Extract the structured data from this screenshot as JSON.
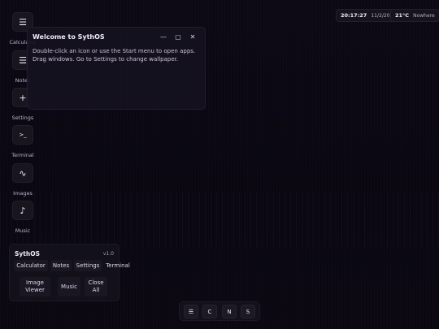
{
  "desktop_icons": [
    {
      "label": "Calculator",
      "glyph": "☰",
      "icon": "calculator-icon"
    },
    {
      "label": "Notes",
      "glyph": "☰",
      "icon": "notes-icon"
    },
    {
      "label": "Settings",
      "glyph": "+",
      "icon": "settings-icon"
    },
    {
      "label": "Terminal",
      "glyph": ">_",
      "icon": "terminal-icon"
    },
    {
      "label": "Images",
      "glyph": "∿",
      "icon": "images-icon"
    },
    {
      "label": "Music",
      "glyph": "♪",
      "icon": "music-icon"
    }
  ],
  "window": {
    "title": "Welcome to SythOS",
    "minimize_glyph": "—",
    "maximize_glyph": "▢",
    "close_glyph": "✕",
    "body": "Double-click an icon or use the Start menu to open apps. Drag windows. Go to Settings to change wallpaper."
  },
  "clock": {
    "time": "20:17:27",
    "date": "11/2/2025"
  },
  "weather": {
    "temp": "21°C",
    "location": "Nowhere"
  },
  "start_menu": {
    "name": "SythOS",
    "version": "v1.0",
    "apps": [
      "Calculator",
      "Notes",
      "Settings",
      "Terminal",
      "Image Viewer",
      "Music",
      "Close All"
    ]
  },
  "taskbar": {
    "buttons": [
      "☰",
      "C",
      "N",
      "S"
    ]
  },
  "colors": {
    "background": "#0b0813",
    "panel": "#121019",
    "accent_text": "#f0ecf8"
  }
}
